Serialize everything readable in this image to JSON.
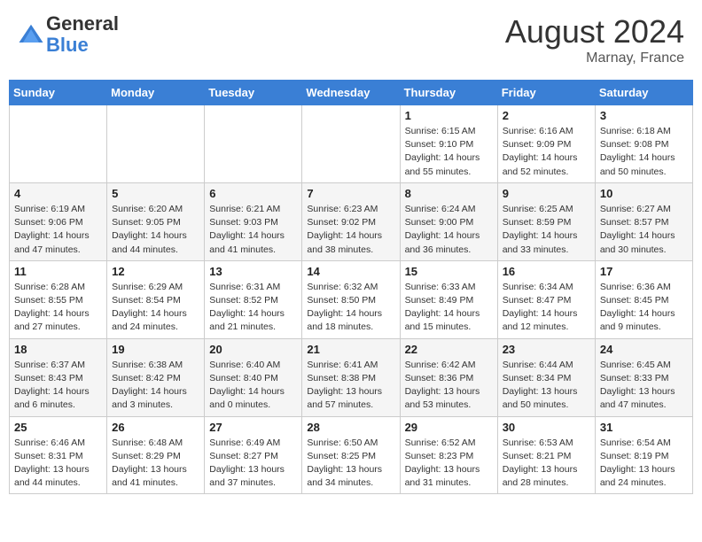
{
  "header": {
    "logo_general": "General",
    "logo_blue": "Blue",
    "month_year": "August 2024",
    "location": "Marnay, France"
  },
  "days_of_week": [
    "Sunday",
    "Monday",
    "Tuesday",
    "Wednesday",
    "Thursday",
    "Friday",
    "Saturday"
  ],
  "weeks": [
    [
      {
        "day": "",
        "info": ""
      },
      {
        "day": "",
        "info": ""
      },
      {
        "day": "",
        "info": ""
      },
      {
        "day": "",
        "info": ""
      },
      {
        "day": "1",
        "info": "Sunrise: 6:15 AM\nSunset: 9:10 PM\nDaylight: 14 hours and 55 minutes."
      },
      {
        "day": "2",
        "info": "Sunrise: 6:16 AM\nSunset: 9:09 PM\nDaylight: 14 hours and 52 minutes."
      },
      {
        "day": "3",
        "info": "Sunrise: 6:18 AM\nSunset: 9:08 PM\nDaylight: 14 hours and 50 minutes."
      }
    ],
    [
      {
        "day": "4",
        "info": "Sunrise: 6:19 AM\nSunset: 9:06 PM\nDaylight: 14 hours and 47 minutes."
      },
      {
        "day": "5",
        "info": "Sunrise: 6:20 AM\nSunset: 9:05 PM\nDaylight: 14 hours and 44 minutes."
      },
      {
        "day": "6",
        "info": "Sunrise: 6:21 AM\nSunset: 9:03 PM\nDaylight: 14 hours and 41 minutes."
      },
      {
        "day": "7",
        "info": "Sunrise: 6:23 AM\nSunset: 9:02 PM\nDaylight: 14 hours and 38 minutes."
      },
      {
        "day": "8",
        "info": "Sunrise: 6:24 AM\nSunset: 9:00 PM\nDaylight: 14 hours and 36 minutes."
      },
      {
        "day": "9",
        "info": "Sunrise: 6:25 AM\nSunset: 8:59 PM\nDaylight: 14 hours and 33 minutes."
      },
      {
        "day": "10",
        "info": "Sunrise: 6:27 AM\nSunset: 8:57 PM\nDaylight: 14 hours and 30 minutes."
      }
    ],
    [
      {
        "day": "11",
        "info": "Sunrise: 6:28 AM\nSunset: 8:55 PM\nDaylight: 14 hours and 27 minutes."
      },
      {
        "day": "12",
        "info": "Sunrise: 6:29 AM\nSunset: 8:54 PM\nDaylight: 14 hours and 24 minutes."
      },
      {
        "day": "13",
        "info": "Sunrise: 6:31 AM\nSunset: 8:52 PM\nDaylight: 14 hours and 21 minutes."
      },
      {
        "day": "14",
        "info": "Sunrise: 6:32 AM\nSunset: 8:50 PM\nDaylight: 14 hours and 18 minutes."
      },
      {
        "day": "15",
        "info": "Sunrise: 6:33 AM\nSunset: 8:49 PM\nDaylight: 14 hours and 15 minutes."
      },
      {
        "day": "16",
        "info": "Sunrise: 6:34 AM\nSunset: 8:47 PM\nDaylight: 14 hours and 12 minutes."
      },
      {
        "day": "17",
        "info": "Sunrise: 6:36 AM\nSunset: 8:45 PM\nDaylight: 14 hours and 9 minutes."
      }
    ],
    [
      {
        "day": "18",
        "info": "Sunrise: 6:37 AM\nSunset: 8:43 PM\nDaylight: 14 hours and 6 minutes."
      },
      {
        "day": "19",
        "info": "Sunrise: 6:38 AM\nSunset: 8:42 PM\nDaylight: 14 hours and 3 minutes."
      },
      {
        "day": "20",
        "info": "Sunrise: 6:40 AM\nSunset: 8:40 PM\nDaylight: 14 hours and 0 minutes."
      },
      {
        "day": "21",
        "info": "Sunrise: 6:41 AM\nSunset: 8:38 PM\nDaylight: 13 hours and 57 minutes."
      },
      {
        "day": "22",
        "info": "Sunrise: 6:42 AM\nSunset: 8:36 PM\nDaylight: 13 hours and 53 minutes."
      },
      {
        "day": "23",
        "info": "Sunrise: 6:44 AM\nSunset: 8:34 PM\nDaylight: 13 hours and 50 minutes."
      },
      {
        "day": "24",
        "info": "Sunrise: 6:45 AM\nSunset: 8:33 PM\nDaylight: 13 hours and 47 minutes."
      }
    ],
    [
      {
        "day": "25",
        "info": "Sunrise: 6:46 AM\nSunset: 8:31 PM\nDaylight: 13 hours and 44 minutes."
      },
      {
        "day": "26",
        "info": "Sunrise: 6:48 AM\nSunset: 8:29 PM\nDaylight: 13 hours and 41 minutes."
      },
      {
        "day": "27",
        "info": "Sunrise: 6:49 AM\nSunset: 8:27 PM\nDaylight: 13 hours and 37 minutes."
      },
      {
        "day": "28",
        "info": "Sunrise: 6:50 AM\nSunset: 8:25 PM\nDaylight: 13 hours and 34 minutes."
      },
      {
        "day": "29",
        "info": "Sunrise: 6:52 AM\nSunset: 8:23 PM\nDaylight: 13 hours and 31 minutes."
      },
      {
        "day": "30",
        "info": "Sunrise: 6:53 AM\nSunset: 8:21 PM\nDaylight: 13 hours and 28 minutes."
      },
      {
        "day": "31",
        "info": "Sunrise: 6:54 AM\nSunset: 8:19 PM\nDaylight: 13 hours and 24 minutes."
      }
    ]
  ]
}
